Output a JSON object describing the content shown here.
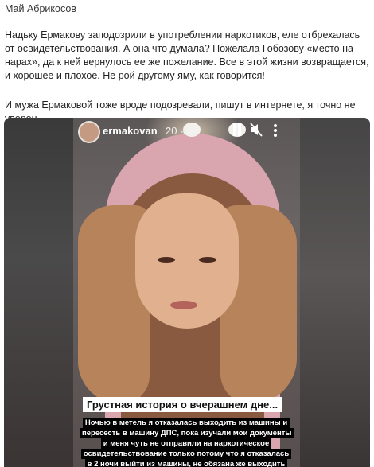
{
  "post": {
    "author": "Май Абрикосов",
    "paragraph_1": "Надьку Ермакову заподозрили в употреблении наркотиков, еле отбрехалась от освидетельствования. А она что думала? Пожелала Гобозову «место на нарах», да к ней вернулось ее же пожелание. Все в этой жизни возвращается, и хорошее и плохое. Не рой другому яму, как говорится!",
    "paragraph_2": "И мужа Ермаковой тоже вроде подозревали, пишут в интернете, я точно не уверен"
  },
  "story": {
    "username": "ermakovan",
    "time_ago": "20 ч.",
    "caption_title": "Грустная история о вчерашнем дне...",
    "caption_body": "Ночью в метель я отказалась выходить из машины и пересесть в машину ДПС, пока изучали мои документы и меня чуть не отправили на наркотическое освидетельствование только потому что я отказалась в 2 ночи выйти из машины, не обязана же выходить по"
  },
  "icons": {
    "pause": "pause-icon",
    "mute": "volume-mute-icon",
    "more": "more-vertical-icon"
  },
  "colors": {
    "caption_title_bg": "#ffffff",
    "caption_body_bg": "#000000"
  }
}
